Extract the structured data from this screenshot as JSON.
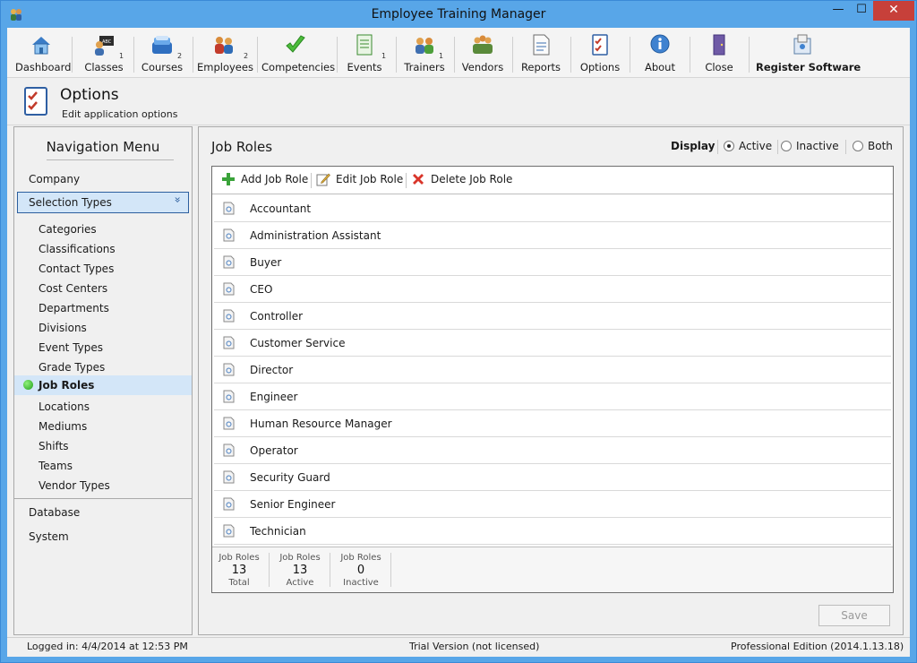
{
  "window": {
    "title": "Employee Training Manager",
    "minimize": "—",
    "maximize": "☐",
    "close": "✕"
  },
  "toolbar": {
    "items": [
      {
        "label": "Dashboard",
        "badge": ""
      },
      {
        "label": "Classes",
        "badge": "1"
      },
      {
        "label": "Courses",
        "badge": "2"
      },
      {
        "label": "Employees",
        "badge": "2"
      },
      {
        "label": "Competencies",
        "badge": ""
      },
      {
        "label": "Events",
        "badge": "1"
      },
      {
        "label": "Trainers",
        "badge": "1"
      },
      {
        "label": "Vendors",
        "badge": ""
      },
      {
        "label": "Reports",
        "badge": ""
      },
      {
        "label": "Options",
        "badge": ""
      },
      {
        "label": "About",
        "badge": ""
      },
      {
        "label": "Close",
        "badge": ""
      },
      {
        "label": "Register Software",
        "badge": ""
      }
    ]
  },
  "header": {
    "title": "Options",
    "subtitle": "Edit application options"
  },
  "nav": {
    "title": "Navigation Menu",
    "company": "Company",
    "selected_group": "Selection Types",
    "chevron": "»",
    "sub_items": [
      "Categories",
      "Classifications",
      "Contact Types",
      "Cost Centers",
      "Departments",
      "Divisions",
      "Event Types",
      "Grade Types",
      "Job Roles",
      "Locations",
      "Mediums",
      "Shifts",
      "Teams",
      "Vendor Types"
    ],
    "active_item": "Job Roles",
    "database": "Database",
    "system": "System"
  },
  "content": {
    "title": "Job Roles",
    "display_label": "Display",
    "display_options": [
      "Active",
      "Inactive",
      "Both"
    ],
    "display_selected": "Active",
    "actions": {
      "add": "Add Job Role",
      "edit": "Edit Job Role",
      "delete": "Delete Job Role"
    },
    "rows": [
      "Accountant",
      "Administration Assistant",
      "Buyer",
      "CEO",
      "Controller",
      "Customer Service",
      "Director",
      "Engineer",
      "Human Resource Manager",
      "Operator",
      "Security Guard",
      "Senior Engineer",
      "Technician"
    ],
    "stats": [
      {
        "label": "Job Roles",
        "value": "13",
        "caption": "Total"
      },
      {
        "label": "Job Roles",
        "value": "13",
        "caption": "Active"
      },
      {
        "label": "Job Roles",
        "value": "0",
        "caption": "Inactive"
      }
    ],
    "save": "Save"
  },
  "status": {
    "left": "Logged in:  4/4/2014 at 12:53 PM",
    "middle": "Trial Version (not licensed)",
    "right": "Professional Edition (2014.1.13.18)"
  },
  "colors": {
    "accent": "#58a6e8",
    "selection": "#d3e6f8",
    "close_button": "#c7403a",
    "active_dot": "#1f9f1a"
  },
  "icons": [
    "dashboard-icon",
    "classes-icon",
    "courses-icon",
    "employees-icon",
    "competencies-icon",
    "events-icon",
    "trainers-icon",
    "vendors-icon",
    "reports-icon",
    "options-icon",
    "about-icon",
    "close-door-icon",
    "register-icon"
  ]
}
